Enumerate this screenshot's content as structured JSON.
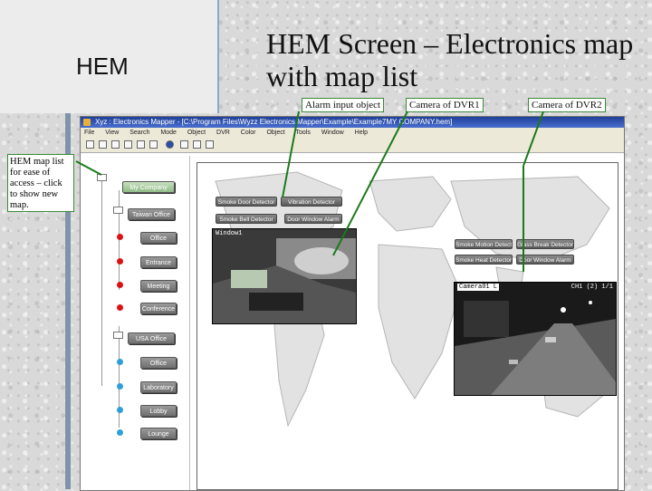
{
  "slide": {
    "side_label": "HEM",
    "title_line1": "HEM Screen – Electronics map",
    "title_line2": "with map list"
  },
  "callouts": {
    "alarm": "Alarm input object",
    "camera1": "Camera of DVR1",
    "camera2": "Camera of DVR2",
    "map_list": "HEM map list for ease of access – click to show new map."
  },
  "app": {
    "title": "Xyz : Electronics Mapper - [C:\\Program Files\\Wyzz Electronics Mapper\\Example\\Example7MY COMPANY.hem]",
    "menu": [
      "File",
      "View",
      "Search",
      "Mode",
      "Object",
      "DVR",
      "Color",
      "Object",
      "Tools",
      "Window",
      "Help"
    ],
    "tree": {
      "root": "My Company",
      "group1": "Taiwan Office",
      "group1_items": [
        "Office",
        "Entrance",
        "Meeting",
        "Conference"
      ],
      "group2": "USA Office",
      "group2_items": [
        "Office",
        "Laboratory",
        "Lobby",
        "Lounge"
      ]
    },
    "map_buttons_left": [
      "Smoke Door Detector",
      "Vibration Detector",
      "Smoke Bell Detector",
      "Door Window Alarm"
    ],
    "map_buttons_right": [
      "Smoke Motion Detector",
      "Glass Break Detector",
      "Smoke Heat Detector",
      "Door Window Alarm"
    ],
    "camera1": {
      "label": "Window1"
    },
    "camera2": {
      "label": "Camera01 L",
      "extra": "CH1 (2) 1/1"
    }
  }
}
